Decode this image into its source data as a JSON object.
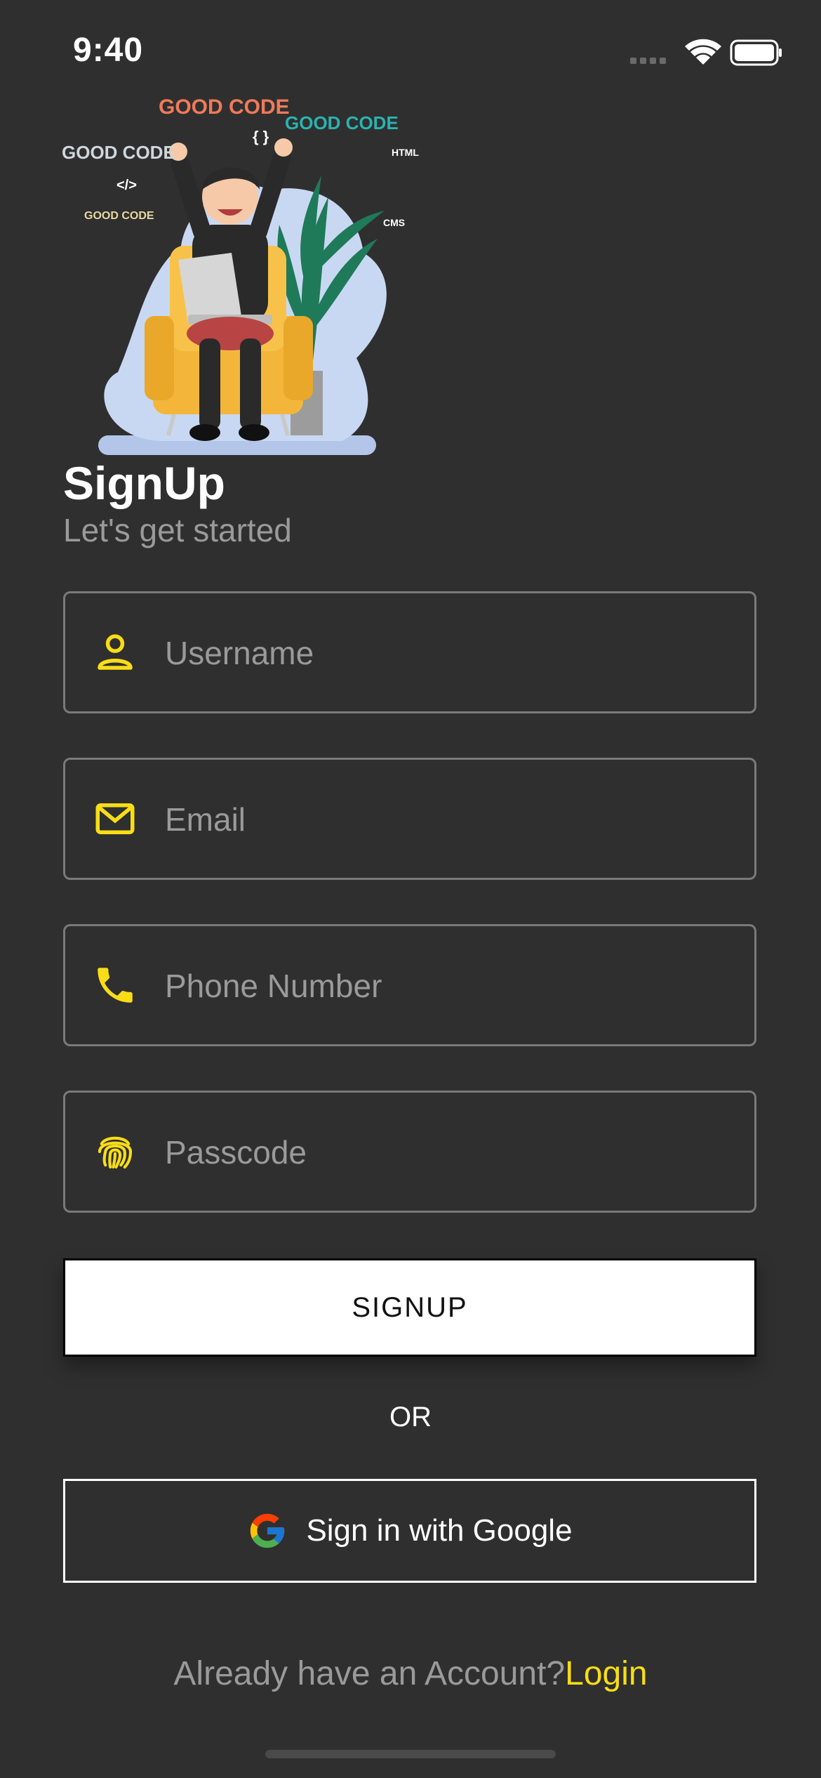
{
  "status": {
    "time": "9:40"
  },
  "illustration": {
    "labels": [
      "GOOD CODE",
      "GOOD CODE",
      "GOOD CODE",
      "GOOD CODE",
      "{ }",
      "</>",
      "HTML",
      "CMS"
    ]
  },
  "header": {
    "title": "SignUp",
    "subtitle": "Let's get started"
  },
  "form": {
    "username": {
      "placeholder": "Username",
      "value": ""
    },
    "email": {
      "placeholder": "Email",
      "value": ""
    },
    "phone": {
      "placeholder": "Phone Number",
      "value": ""
    },
    "passcode": {
      "placeholder": "Passcode",
      "value": ""
    }
  },
  "actions": {
    "signup_label": "SIGNUP",
    "or_label": "OR",
    "google_label": "Sign in with Google"
  },
  "footer": {
    "prompt": "Already have an Account?",
    "login_label": "Login"
  },
  "colors": {
    "background": "#2f2f2f",
    "accent": "#f8dd17",
    "muted": "#9a9a9a"
  }
}
